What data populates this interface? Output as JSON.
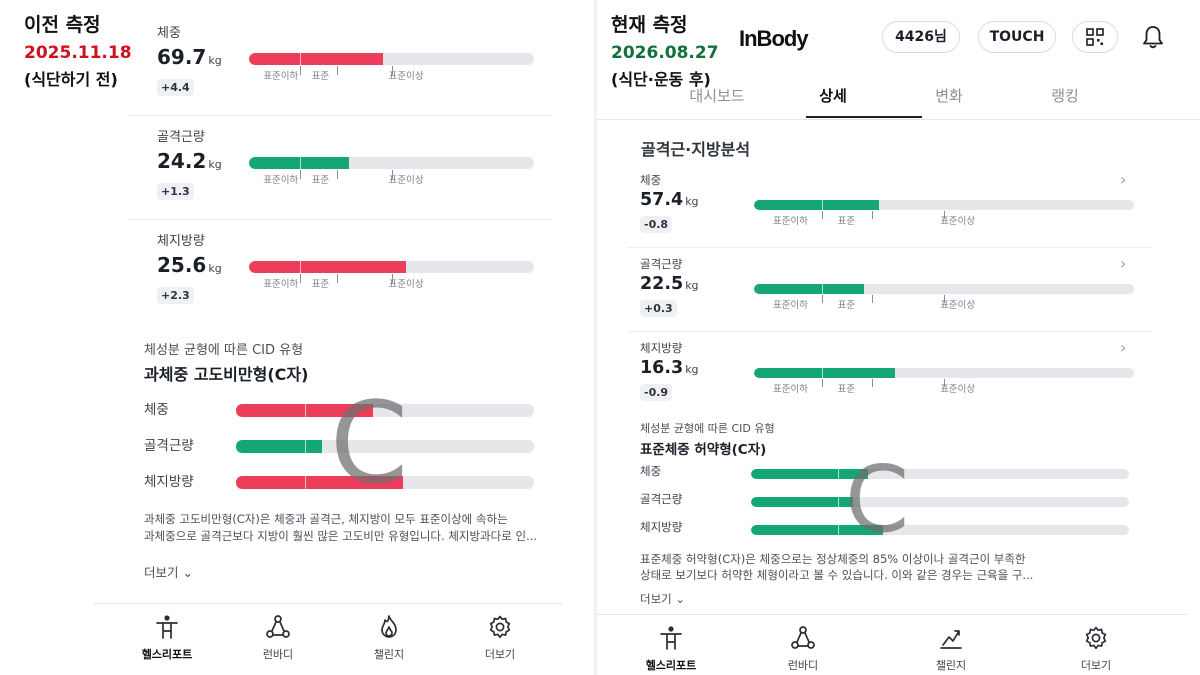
{
  "left": {
    "caption": {
      "title": "이전 측정",
      "date": "2025.11.18",
      "date_color": "#d0101e",
      "sub": "(식단하기 전)"
    },
    "metrics": [
      {
        "name": "체중",
        "value": "69.7",
        "unit": "kg",
        "delta": "+4.4",
        "level": 0.47,
        "color": "#ec3e5b"
      },
      {
        "name": "골격근량",
        "value": "24.2",
        "unit": "kg",
        "delta": "+1.3",
        "level": 0.35,
        "color": "#14a674"
      },
      {
        "name": "체지방량",
        "value": "25.6",
        "unit": "kg",
        "delta": "+2.3",
        "level": 0.55,
        "color": "#ec3e5b"
      }
    ],
    "range_labels": [
      "표준이하",
      "표준",
      "표준이상"
    ],
    "cid": {
      "caption": "체성분 균형에 따른 CID 유형",
      "title": "과체중 고도비만형(C자)",
      "rows": [
        {
          "label": "체중",
          "level": 0.46,
          "color": "#ec3e5b"
        },
        {
          "label": "골격근량",
          "level": 0.29,
          "color": "#14a674"
        },
        {
          "label": "체지방량",
          "level": 0.56,
          "color": "#ec3e5b"
        }
      ],
      "letter": "C",
      "desc1": "과체중 고도비만형(C자)은 체중과 골격근, 체지방이 모두 표준이상에 속하는",
      "desc2": "과체중으로 골격근보다 지방이 훨씬 많은 고도비만 유형입니다. 체지방과다로 인...",
      "more": "더보기 ⌄"
    },
    "nav": [
      {
        "label": "헬스리포트",
        "icon": "health-report-icon",
        "active": true
      },
      {
        "label": "런바디",
        "icon": "run-body-icon",
        "active": false
      },
      {
        "label": "챌린지",
        "icon": "challenge-flame-icon",
        "active": false
      },
      {
        "label": "더보기",
        "icon": "gear-icon",
        "active": false
      }
    ]
  },
  "right": {
    "caption": {
      "title": "현재 측정",
      "date": "2026.08.27",
      "date_color": "#11703a",
      "sub": "(식단·운동 후)"
    },
    "logo": "InBody",
    "user_pill": "4426님",
    "touch_pill": "TOUCH",
    "tabs": [
      {
        "label": "대시보드",
        "active": false
      },
      {
        "label": "상세",
        "active": true
      },
      {
        "label": "변화",
        "active": false
      },
      {
        "label": "랭킹",
        "active": false
      }
    ],
    "section_title": "골격근·지방분석",
    "metrics": [
      {
        "name": "체중",
        "value": "57.4",
        "unit": "kg",
        "delta": "-0.8",
        "level": 0.33,
        "color": "#14a674"
      },
      {
        "name": "골격근량",
        "value": "22.5",
        "unit": "kg",
        "delta": "+0.3",
        "level": 0.29,
        "color": "#14a674"
      },
      {
        "name": "체지방량",
        "value": "16.3",
        "unit": "kg",
        "delta": "-0.9",
        "level": 0.37,
        "color": "#14a674"
      }
    ],
    "range_labels": [
      "표준이하",
      "표준",
      "표준이상"
    ],
    "cid": {
      "caption": "체성분 균형에 따른 CID 유형",
      "title": "표준체중 허약형(C자)",
      "rows": [
        {
          "label": "체중",
          "level": 0.31,
          "color": "#14a674"
        },
        {
          "label": "골격근량",
          "level": 0.27,
          "color": "#14a674"
        },
        {
          "label": "체지방량",
          "level": 0.35,
          "color": "#14a674"
        }
      ],
      "letter": "C",
      "desc1": "표준체중 허약형(C자)은 체중으로는 정상체중의 85% 이상이나 골격근이 부족한",
      "desc2": "상태로 보기보다 허약한 체형이라고 볼 수 있습니다. 이와 같은 경우는 근육을 구...",
      "more": "더보기 ⌄"
    },
    "nav": [
      {
        "label": "헬스리포트",
        "icon": "health-report-icon",
        "active": true
      },
      {
        "label": "런바디",
        "icon": "run-body-icon",
        "active": false
      },
      {
        "label": "챌린지",
        "icon": "challenge-chart-icon",
        "active": false
      },
      {
        "label": "더보기",
        "icon": "gear-icon",
        "active": false
      }
    ]
  }
}
